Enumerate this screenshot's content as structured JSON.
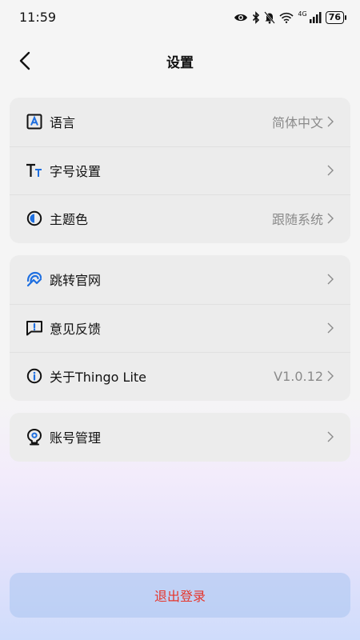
{
  "status_bar": {
    "time": "11:59",
    "network": "4G",
    "battery": "76"
  },
  "header": {
    "title": "设置"
  },
  "groups": [
    {
      "items": [
        {
          "label": "语言",
          "value": "简体中文",
          "icon": "language-icon"
        },
        {
          "label": "字号设置",
          "value": "",
          "icon": "font-size-icon"
        },
        {
          "label": "主题色",
          "value": "跟随系统",
          "icon": "theme-icon"
        }
      ]
    },
    {
      "items": [
        {
          "label": "跳转官网",
          "value": "",
          "icon": "website-icon"
        },
        {
          "label": "意见反馈",
          "value": "",
          "icon": "feedback-icon"
        },
        {
          "label": "关于Thingo Lite",
          "value": "V1.0.12",
          "icon": "info-icon"
        }
      ]
    },
    {
      "items": [
        {
          "label": "账号管理",
          "value": "",
          "icon": "account-icon"
        }
      ]
    }
  ],
  "logout": {
    "label": "退出登录",
    "color": "#e6352b"
  },
  "colors": {
    "accent_blue": "#1e6fe0",
    "value_text": "#8a8a8a"
  }
}
